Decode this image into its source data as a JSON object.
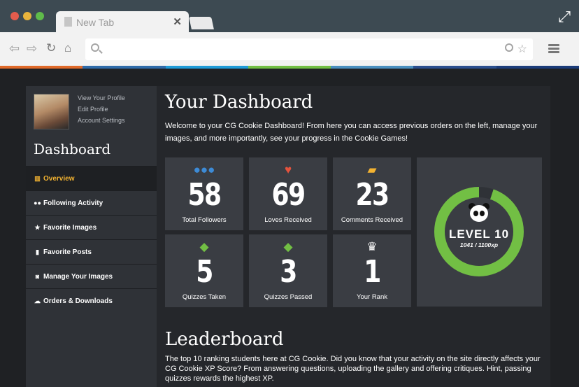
{
  "browser": {
    "tab_title": "New Tab",
    "tab_close": "✕",
    "url_value": "",
    "colors": [
      "#e06a2a",
      "#2e6aa8",
      "#1f9bd7",
      "#72bf44",
      "#4a8fbf",
      "#2b4f8e",
      "#1c3d7a"
    ]
  },
  "icons": {
    "back": "back-arrow-icon",
    "forward": "forward-arrow-icon",
    "reload": "reload-icon",
    "home": "home-icon",
    "search": "search-icon",
    "zoom": "zoom-icon",
    "star": "star-icon",
    "menu": "hamburger-menu-icon",
    "expand": "expand-icon"
  },
  "sidebar": {
    "profile_links": [
      "View Your Profile",
      "Edit Profile",
      "Account Settings"
    ],
    "title": "Dashboard",
    "items": [
      {
        "label": "Overview",
        "icon": "chart-icon",
        "active": true
      },
      {
        "label": "Following Activity",
        "icon": "users-icon"
      },
      {
        "label": "Favorite Images",
        "icon": "star-icon"
      },
      {
        "label": "Favorite Posts",
        "icon": "bookmark-icon"
      },
      {
        "label": "Manage Your Images",
        "icon": "camera-icon"
      },
      {
        "label": "Orders & Downloads",
        "icon": "cloud-download-icon"
      }
    ]
  },
  "main": {
    "title": "Your Dashboard",
    "intro": "Welcome to your CG Cookie Dashboard! From here you can access previous orders on the left, manage your images, and more importantly, see your progress in the Cookie Games!",
    "stats": [
      {
        "value": "58",
        "label": "Total Followers",
        "icon": "users-icon",
        "color": "#3d8bd6"
      },
      {
        "value": "69",
        "label": "Loves Received",
        "icon": "heart-icon",
        "color": "#e5533d"
      },
      {
        "value": "23",
        "label": "Comments Received",
        "icon": "comments-icon",
        "color": "#f3b331"
      },
      {
        "value": "5",
        "label": "Quizzes Taken",
        "icon": "graduation-cap-icon",
        "color": "#72bf44"
      },
      {
        "value": "3",
        "label": "Quizzes Passed",
        "icon": "graduation-cap-icon",
        "color": "#72bf44"
      },
      {
        "value": "1",
        "label": "Your Rank",
        "icon": "trophy-icon",
        "color": "#ffffff"
      }
    ],
    "level": {
      "label": "LEVEL 10",
      "xp": "1041 / 1100xp",
      "progress_fraction": 0.946,
      "ring_color": "#72bf44"
    },
    "leaderboard": {
      "title": "Leaderboard",
      "text": "The top 10 ranking students here at CG Cookie. Did you know that your activity on the site directly affects your CG Cookie XP Score? From answering questions, uploading the gallery and offering critiques. Hint, passing quizzes rewards the highest XP."
    }
  }
}
